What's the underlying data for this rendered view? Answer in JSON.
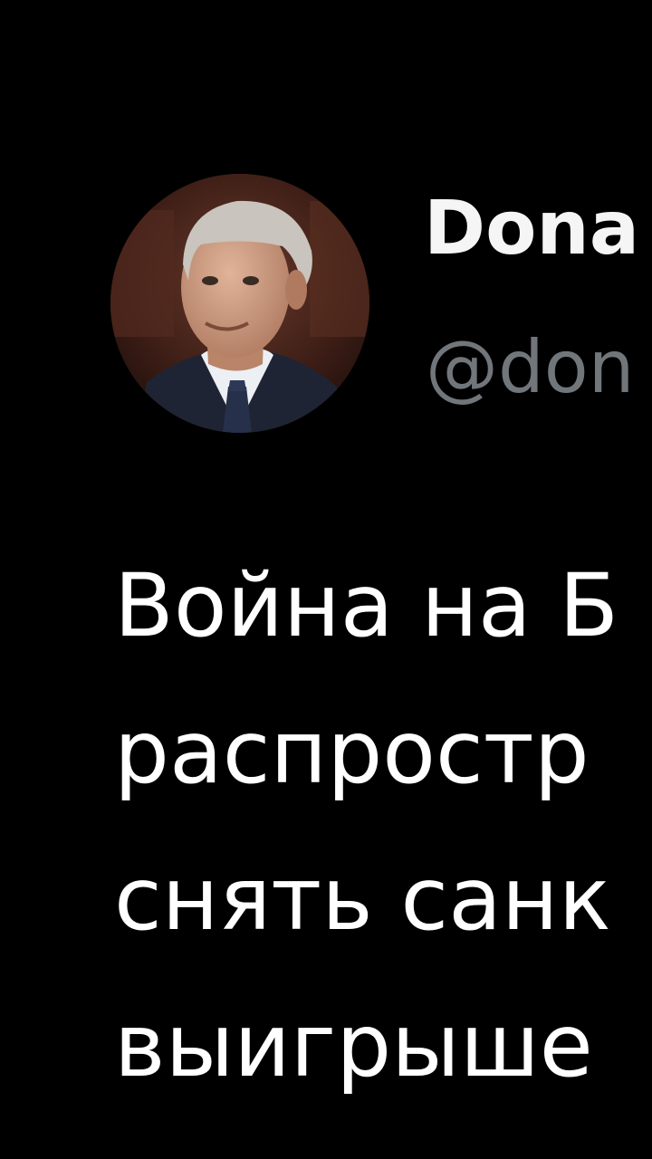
{
  "author": {
    "display_name": "Dona",
    "handle": "@don",
    "avatar_icon": "profile-photo"
  },
  "tweet": {
    "lines": [
      "Война на Б",
      "распростр",
      "снять санк",
      "выигрыше"
    ]
  },
  "colors": {
    "background": "#000000",
    "text": "#ffffff",
    "secondary_text": "#71767b"
  }
}
